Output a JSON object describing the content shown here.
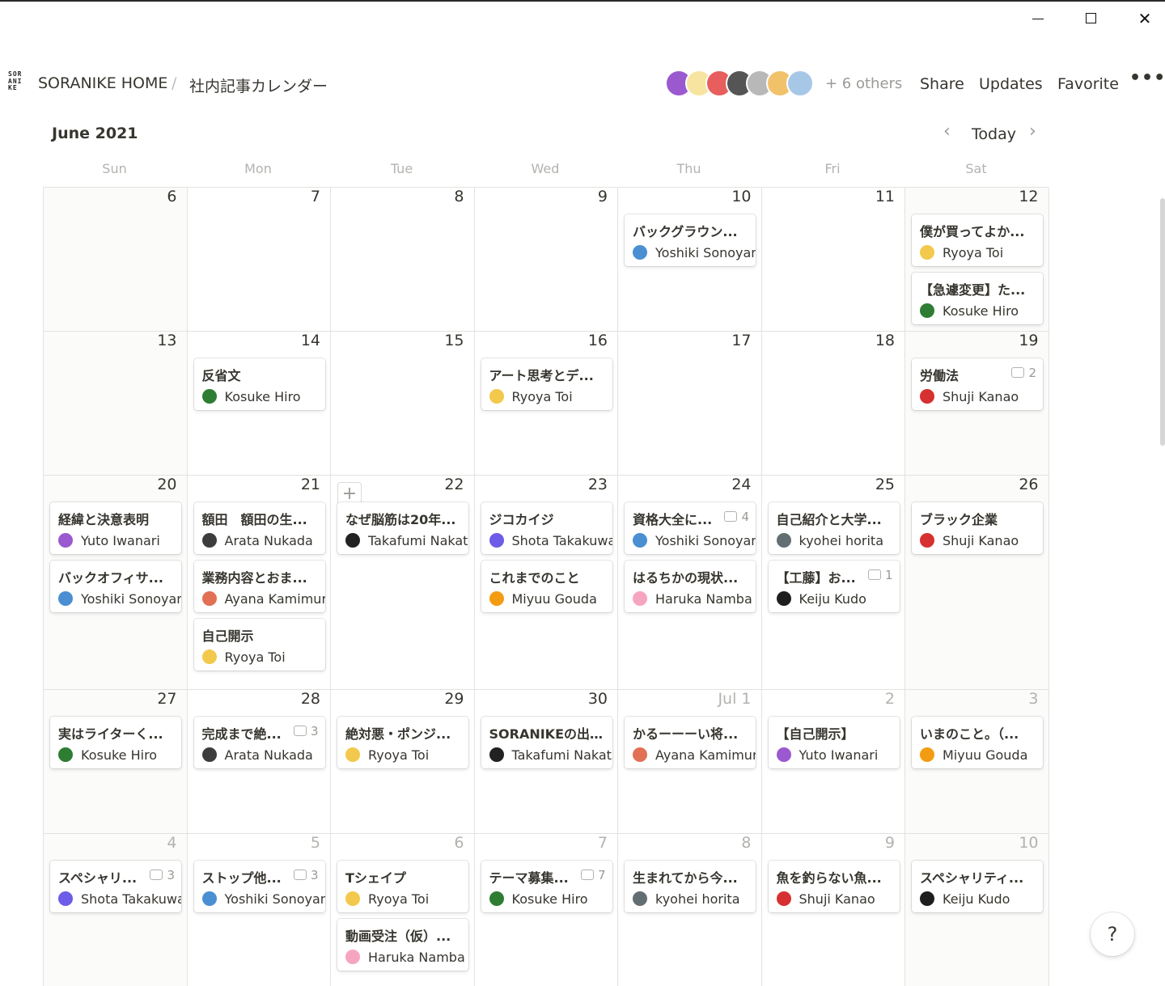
{
  "breadcrumb": {
    "workspace": "SORANIKE HOME",
    "page": "社内記事カレンダー",
    "logo_lines": [
      "SOR",
      "ANI",
      "KE"
    ]
  },
  "topbar": {
    "others": "+ 6 others",
    "share": "Share",
    "updates": "Updates",
    "favorite": "Favorite"
  },
  "avatar_colors": [
    "#9b59d0",
    "#f7e4a0",
    "#e85d5d",
    "#555555",
    "#b8b8b8",
    "#f2c26b",
    "#a7c7e7"
  ],
  "calendar": {
    "month": "June 2021",
    "today": "Today",
    "weekdays": [
      "Sun",
      "Mon",
      "Tue",
      "Wed",
      "Thu",
      "Fri",
      "Sat"
    ],
    "weeks": [
      [
        {
          "day": "6",
          "cards": []
        },
        {
          "day": "7",
          "cards": []
        },
        {
          "day": "8",
          "cards": []
        },
        {
          "day": "9",
          "cards": []
        },
        {
          "day": "10",
          "cards": [
            {
              "title": "バックグラウン...",
              "author": "Yoshiki Sonoyama",
              "color": "#4a8fd1"
            }
          ]
        },
        {
          "day": "11",
          "cards": []
        },
        {
          "day": "12",
          "cards": [
            {
              "title": "僕が買ってよか...",
              "author": "Ryoya Toi",
              "color": "#f2c94c"
            },
            {
              "title": "【急遽変更】た...",
              "author": "Kosuke Hiro",
              "color": "#2e7d32"
            }
          ]
        }
      ],
      [
        {
          "day": "13",
          "cards": []
        },
        {
          "day": "14",
          "cards": [
            {
              "title": "反省文",
              "author": "Kosuke Hiro",
              "color": "#2e7d32"
            }
          ]
        },
        {
          "day": "15",
          "cards": []
        },
        {
          "day": "16",
          "cards": [
            {
              "title": "アート思考とデ...",
              "author": "Ryoya Toi",
              "color": "#f2c94c"
            }
          ]
        },
        {
          "day": "17",
          "cards": []
        },
        {
          "day": "18",
          "cards": []
        },
        {
          "day": "19",
          "cards": [
            {
              "title": "労働法",
              "author": "Shuji Kanao",
              "color": "#d63031",
              "comments": "2"
            }
          ]
        }
      ],
      [
        {
          "day": "20",
          "cards": [
            {
              "title": "経緯と決意表明",
              "author": "Yuto Iwanari",
              "color": "#9b59d0"
            },
            {
              "title": "バックオフィサ...",
              "author": "Yoshiki Sonoyama",
              "color": "#4a8fd1"
            }
          ]
        },
        {
          "day": "21",
          "cards": [
            {
              "title": "額田　額田の生...",
              "author": "Arata Nukada",
              "color": "#3d3d3d"
            },
            {
              "title": "業務内容とおま...",
              "author": "Ayana Kamimura",
              "color": "#e17055"
            },
            {
              "title": "自己開示",
              "author": "Ryoya Toi",
              "color": "#f2c94c"
            }
          ]
        },
        {
          "day": "22",
          "add": true,
          "cards": [
            {
              "title": "なぜ脳筋は20年...",
              "author": "Takafumi Nakatsu",
              "color": "#222222"
            }
          ]
        },
        {
          "day": "23",
          "cards": [
            {
              "title": "ジコカイジ",
              "author": "Shota Takakuwa",
              "color": "#6c5ce7"
            },
            {
              "title": "これまでのこと",
              "author": "Miyuu Gouda",
              "color": "#f39c12"
            }
          ]
        },
        {
          "day": "24",
          "cards": [
            {
              "title": "資格大全に...",
              "author": "Yoshiki Sonoyama",
              "color": "#4a8fd1",
              "comments": "4"
            },
            {
              "title": "はるちかの現状...",
              "author": "Haruka Namba",
              "color": "#f6a5c0"
            }
          ]
        },
        {
          "day": "25",
          "cards": [
            {
              "title": "自己紹介と大学...",
              "author": "kyohei horita",
              "color": "#636e72"
            },
            {
              "title": "【工藤】お...",
              "author": "Keiju Kudo",
              "color": "#1e1e1e",
              "comments": "1"
            }
          ]
        },
        {
          "day": "26",
          "cards": [
            {
              "title": "ブラック企業",
              "author": "Shuji Kanao",
              "color": "#d63031"
            }
          ]
        }
      ],
      [
        {
          "day": "27",
          "cards": [
            {
              "title": "実はライターく...",
              "author": "Kosuke Hiro",
              "color": "#2e7d32"
            }
          ]
        },
        {
          "day": "28",
          "cards": [
            {
              "title": "完成まで絶...",
              "author": "Arata Nukada",
              "color": "#3d3d3d",
              "comments": "3"
            }
          ]
        },
        {
          "day": "29",
          "cards": [
            {
              "title": "絶対悪・ポンジ...",
              "author": "Ryoya Toi",
              "color": "#f2c94c"
            }
          ]
        },
        {
          "day": "30",
          "cards": [
            {
              "title": "SORANIKEの出...",
              "author": "Takafumi Nakatsu",
              "color": "#222222"
            }
          ]
        },
        {
          "day": "Jul 1",
          "muted": true,
          "cards": [
            {
              "title": "かるーーーい将...",
              "author": "Ayana Kamimura",
              "color": "#e17055"
            }
          ]
        },
        {
          "day": "2",
          "muted": true,
          "cards": [
            {
              "title": "【自己開示】",
              "author": "Yuto Iwanari",
              "color": "#9b59d0"
            }
          ]
        },
        {
          "day": "3",
          "muted": true,
          "cards": [
            {
              "title": "いまのこと。（...",
              "author": "Miyuu Gouda",
              "color": "#f39c12"
            }
          ]
        }
      ],
      [
        {
          "day": "4",
          "muted": true,
          "cards": [
            {
              "title": "スペシャリ...",
              "author": "Shota Takakuwa",
              "color": "#6c5ce7",
              "comments": "3"
            }
          ]
        },
        {
          "day": "5",
          "muted": true,
          "cards": [
            {
              "title": "ストップ他...",
              "author": "Yoshiki Sonoyama",
              "color": "#4a8fd1",
              "comments": "3"
            }
          ]
        },
        {
          "day": "6",
          "muted": true,
          "cards": [
            {
              "title": "Tシェイプ",
              "author": "Ryoya Toi",
              "color": "#f2c94c"
            },
            {
              "title": "動画受注（仮）...",
              "author": "Haruka Namba",
              "color": "#f6a5c0"
            }
          ]
        },
        {
          "day": "7",
          "muted": true,
          "cards": [
            {
              "title": "テーマ募集...",
              "author": "Kosuke Hiro",
              "color": "#2e7d32",
              "comments": "7"
            }
          ]
        },
        {
          "day": "8",
          "muted": true,
          "cards": [
            {
              "title": "生まれてから今...",
              "author": "kyohei horita",
              "color": "#636e72"
            }
          ]
        },
        {
          "day": "9",
          "muted": true,
          "cards": [
            {
              "title": "魚を釣らない魚...",
              "author": "Shuji Kanao",
              "color": "#d63031"
            }
          ]
        },
        {
          "day": "10",
          "muted": true,
          "cards": [
            {
              "title": "スペシャリティ...",
              "author": "Keiju Kudo",
              "color": "#1e1e1e"
            }
          ]
        }
      ]
    ]
  }
}
